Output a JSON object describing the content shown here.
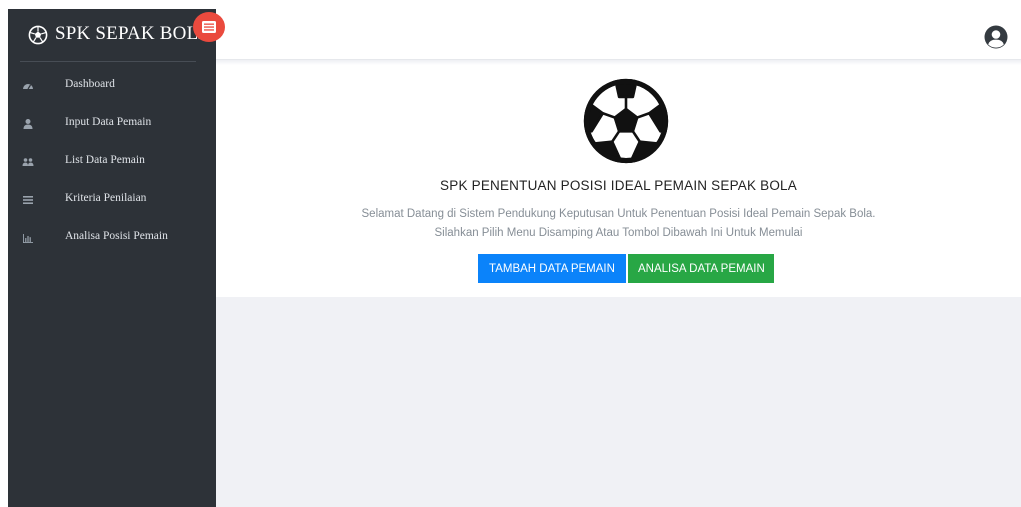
{
  "brand": {
    "title": "SPK SEPAK BOLA",
    "icon": "soccer-ball-icon"
  },
  "sidebar": {
    "items": [
      {
        "label": "Dashboard",
        "icon": "dashboard-icon"
      },
      {
        "label": "Input Data Pemain",
        "icon": "user-icon"
      },
      {
        "label": "List Data Pemain",
        "icon": "users-icon"
      },
      {
        "label": "Kriteria Penilaian",
        "icon": "list-icon"
      },
      {
        "label": "Analisa Posisi Pemain",
        "icon": "bar-chart-icon"
      }
    ]
  },
  "header": {
    "avatar_icon": "user-avatar-icon",
    "toggle_icon": "menu-toggle-icon"
  },
  "hero": {
    "title": "SPK PENENTUAN POSISI IDEAL PEMAIN SEPAK BOLA",
    "line1": "Selamat Datang di Sistem Pendukung Keputusan Untuk Penentuan Posisi Ideal Pemain Sepak Bola.",
    "line2": "Silahkan Pilih Menu Disamping Atau Tombol Dibawah Ini Untuk Memulai",
    "primary_button": "TAMBAH DATA PEMAIN",
    "secondary_button": "ANALISA DATA PEMAIN"
  },
  "colors": {
    "sidebar_bg": "#2d3238",
    "toggle": "#ea4a3e",
    "primary": "#0b83fa",
    "success": "#28a745",
    "content_bg": "#f0f1f5"
  }
}
